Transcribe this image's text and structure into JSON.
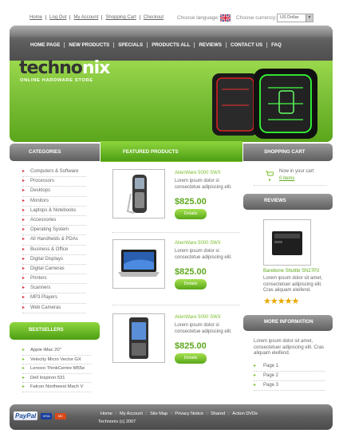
{
  "top_links": [
    "Home",
    "Log Out",
    "My Account",
    "Shopping Cart",
    "Checkout"
  ],
  "language_label": "Choose language:",
  "currency_label": "Choose currency:",
  "currency_value": "US Dollar",
  "nav": [
    "HOME PAGE",
    "NEW PRODUCTS",
    "SPECIALS",
    "PRODUCTS ALL",
    "REVIEWS",
    "CONTACT US",
    "FAQ"
  ],
  "logo": {
    "part1": "techno",
    "part2": "nix",
    "slogan": "ONLINE HARDWARE STORE"
  },
  "headers": {
    "categories": "CATEGORIES",
    "featured": "FEATURED PRODUCTS",
    "cart": "SHOPPING CART",
    "reviews": "REVIEWS",
    "bestsellers": "BESTSELLERS",
    "more_info": "MORE INFORMATION"
  },
  "categories": [
    "Computers & Software",
    "Processors",
    "Desktops",
    "Monitors",
    "Laptops & Notebooks",
    "Accessories",
    "Operating System",
    "All Handhelds & PDAs",
    "Business & Office",
    "Digital Displays",
    "Digital Cameras",
    "Printers",
    "Scanners",
    "MP3 Players",
    "Web Cameras"
  ],
  "bestsellers": [
    "Apple iMac 20\"",
    "Velocity Micro Vector GX",
    "Lenovo ThinkCentre M55e",
    "Dell Inspiron 531",
    "Falcon Northwest Mach V"
  ],
  "products": [
    {
      "name": "AlienWare 5000 SWX",
      "desc": "Lorem ipsum dolor si consectetue adipiscing elit.",
      "price": "$825.00",
      "button": "Details"
    },
    {
      "name": "AlienWare 5000 SWX",
      "desc": "Lorem ipsum dolor si consectetue adipiscing elit.",
      "price": "$825.00",
      "button": "Details"
    },
    {
      "name": "AlienWare 5000 SWX",
      "desc": "Lorem ipsum dolor si consectetue adipiscing elit.",
      "price": "$825.00",
      "button": "Details"
    }
  ],
  "cart": {
    "line1": "Now in your cart",
    "line2": "0 items"
  },
  "review": {
    "name": "Barebone Shuttle SN27P2",
    "desc": "Lorem ipsum dolor sit amet, consectetuer adipiscing elit. Cras aliquam eleifend.",
    "rating": 5,
    "stars": "★★★★★"
  },
  "more_info": {
    "desc": "Lorem ipsum dolor sit amet, consectetuer adipiscing elit. Cras aliquam eleifend.",
    "pages": [
      "Page 1",
      "Page 2",
      "Page 3"
    ]
  },
  "footer": {
    "links": [
      "Home",
      "My Account",
      "Site Map",
      "Privacy Notice",
      "Shared",
      "Action DVDs"
    ],
    "copyright": "Technonix (c) 2007",
    "paypal": "PayPal",
    "cards": [
      "VISA",
      "MC"
    ]
  },
  "colors": {
    "accent": "#7bbf2e",
    "dark_bar": "#5e5e5e",
    "bullet_red": "#dd2233",
    "stars": "#e8a800"
  }
}
